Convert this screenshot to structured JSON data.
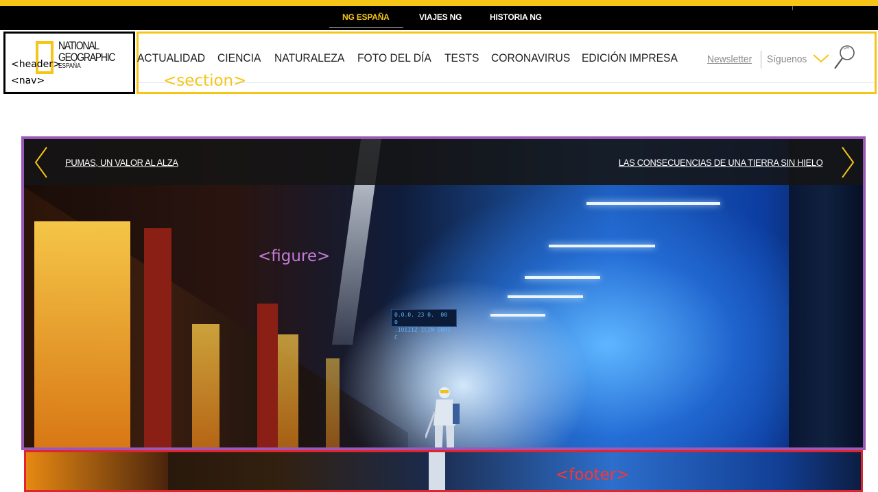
{
  "colors": {
    "brand_yellow": "#f5c518",
    "header_outline": "#000000",
    "section_outline": "#f5c518",
    "figure_outline": "#9b59b6",
    "footer_outline": "#e0242e"
  },
  "top_nav": {
    "items": [
      "NG ESPAÑA",
      "VIAJES NG",
      "HISTORIA NG"
    ],
    "active": "NG ESPAÑA"
  },
  "header": {
    "logo": {
      "line1": "NATIONAL",
      "line2": "GEOGRAPHIC",
      "line3": "ESPAÑA"
    },
    "tags": {
      "header": "<header>",
      "nav": "<nav>"
    }
  },
  "section": {
    "tag": "<section>",
    "nav_items": [
      "ACTUALIDAD",
      "CIENCIA",
      "NATURALEZA",
      "FOTO DEL DÍA",
      "TESTS",
      "CORONAVIRUS",
      "EDICIÓN IMPRESA"
    ],
    "newsletter": "Newsletter",
    "follow": "Síguenos",
    "icons": {
      "follow": "chevron-down-icon",
      "search": "search-icon"
    }
  },
  "figure": {
    "tag": "<figure>",
    "prev_label": "PUMAS, UN VALOR AL ALZA",
    "next_label": "LAS CONSECUENCIAS DE UNA TIERRA SIN HIELO",
    "icons": {
      "prev": "chevron-left-icon",
      "next": "chevron-right-icon"
    }
  },
  "footer": {
    "tag": "<footer>"
  }
}
